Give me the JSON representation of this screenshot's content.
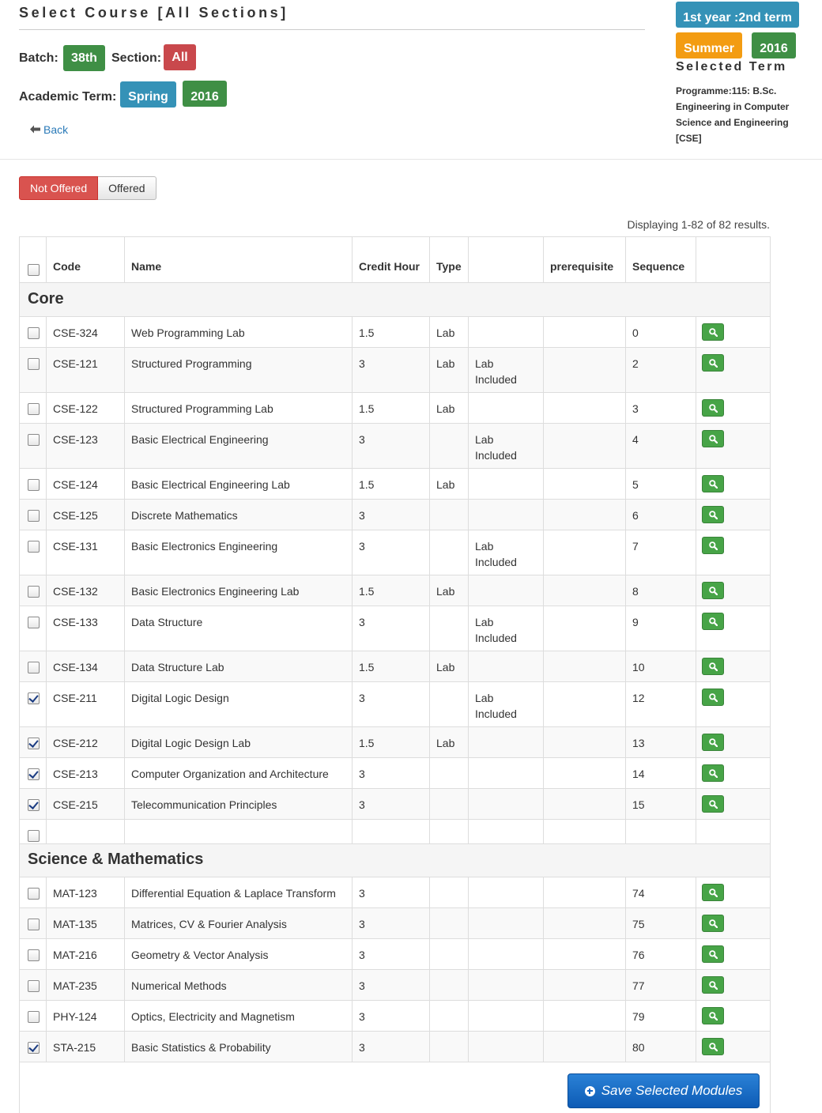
{
  "header": {
    "title": "Select Course [All Sections]",
    "batch_label": "Batch:",
    "batch_value": "38th",
    "section_label": "Section:",
    "section_value": "All",
    "term_label": "Academic Term:",
    "term_value": "Spring",
    "term_year": "2016",
    "back_label": "Back"
  },
  "selected_term": {
    "year_term": "1st year :2nd term",
    "season": "Summer",
    "year": "2016",
    "label": "Selected Term",
    "programme": "Programme:115: B.Sc. Engineering in Computer Science and Engineering [CSE]"
  },
  "filter": {
    "not_offered": "Not Offered",
    "offered": "Offered"
  },
  "summary": "Displaying 1-82 of 82 results.",
  "columns": {
    "code": "Code",
    "name": "Name",
    "credit": "Credit Hour",
    "type": "Type",
    "extra": "",
    "prereq": "prerequisite",
    "sequence": "Sequence"
  },
  "sections": [
    {
      "title": "Core",
      "rows": [
        {
          "code": "CSE-324",
          "name": "Web Programming Lab",
          "credit": "1.5",
          "type": "Lab",
          "extra": "",
          "prereq": "",
          "sequence": "0",
          "checked": false
        },
        {
          "code": "CSE-121",
          "name": "Structured Programming",
          "credit": "3",
          "type": "Lab",
          "extra": "Lab Included",
          "prereq": "",
          "sequence": "2",
          "checked": false
        },
        {
          "code": "CSE-122",
          "name": "Structured Programming Lab",
          "credit": "1.5",
          "type": "Lab",
          "extra": "",
          "prereq": "",
          "sequence": "3",
          "checked": false
        },
        {
          "code": "CSE-123",
          "name": "Basic Electrical Engineering",
          "credit": "3",
          "type": "",
          "extra": "Lab Included",
          "prereq": "",
          "sequence": "4",
          "checked": false
        },
        {
          "code": "CSE-124",
          "name": "Basic Electrical Engineering Lab",
          "credit": "1.5",
          "type": "Lab",
          "extra": "",
          "prereq": "",
          "sequence": "5",
          "checked": false
        },
        {
          "code": "CSE-125",
          "name": "Discrete Mathematics",
          "credit": "3",
          "type": "",
          "extra": "",
          "prereq": "",
          "sequence": "6",
          "checked": false
        },
        {
          "code": "CSE-131",
          "name": "Basic Electronics Engineering",
          "credit": "3",
          "type": "",
          "extra": "Lab Included",
          "prereq": "",
          "sequence": "7",
          "checked": false
        },
        {
          "code": "CSE-132",
          "name": "Basic Electronics Engineering Lab",
          "credit": "1.5",
          "type": "Lab",
          "extra": "",
          "prereq": "",
          "sequence": "8",
          "checked": false
        },
        {
          "code": "CSE-133",
          "name": "Data Structure",
          "credit": "3",
          "type": "",
          "extra": "Lab Included",
          "prereq": "",
          "sequence": "9",
          "checked": false
        },
        {
          "code": "CSE-134",
          "name": "Data Structure Lab",
          "credit": "1.5",
          "type": "Lab",
          "extra": "",
          "prereq": "",
          "sequence": "10",
          "checked": false
        },
        {
          "code": "CSE-211",
          "name": "Digital Logic Design",
          "credit": "3",
          "type": "",
          "extra": "Lab Included",
          "prereq": "",
          "sequence": "12",
          "checked": true
        },
        {
          "code": "CSE-212",
          "name": "Digital Logic Design Lab",
          "credit": "1.5",
          "type": "Lab",
          "extra": "",
          "prereq": "",
          "sequence": "13",
          "checked": true
        },
        {
          "code": "CSE-213",
          "name": "Computer Organization and Architecture",
          "credit": "3",
          "type": "",
          "extra": "",
          "prereq": "",
          "sequence": "14",
          "checked": true
        },
        {
          "code": "CSE-215",
          "name": "Telecommunication Principles",
          "credit": "3",
          "type": "",
          "extra": "",
          "prereq": "",
          "sequence": "15",
          "checked": true
        }
      ]
    },
    {
      "title": "Science & Mathematics",
      "rows": [
        {
          "code": "MAT-123",
          "name": "Differential Equation & Laplace Transform",
          "credit": "3",
          "type": "",
          "extra": "",
          "prereq": "",
          "sequence": "74",
          "checked": false
        },
        {
          "code": "MAT-135",
          "name": "Matrices, CV & Fourier Analysis",
          "credit": "3",
          "type": "",
          "extra": "",
          "prereq": "",
          "sequence": "75",
          "checked": false
        },
        {
          "code": "MAT-216",
          "name": "Geometry & Vector Analysis",
          "credit": "3",
          "type": "",
          "extra": "",
          "prereq": "",
          "sequence": "76",
          "checked": false
        },
        {
          "code": "MAT-235",
          "name": "Numerical Methods",
          "credit": "3",
          "type": "",
          "extra": "",
          "prereq": "",
          "sequence": "77",
          "checked": false
        },
        {
          "code": "PHY-124",
          "name": "Optics, Electricity and Magnetism",
          "credit": "3",
          "type": "",
          "extra": "",
          "prereq": "",
          "sequence": "79",
          "checked": false
        },
        {
          "code": "STA-215",
          "name": "Basic Statistics & Probability",
          "credit": "3",
          "type": "",
          "extra": "",
          "prereq": "",
          "sequence": "80",
          "checked": true
        }
      ]
    }
  ],
  "save_label": "Save Selected Modules",
  "icons": {
    "back": "arrow-left-icon",
    "view": "magnifier-icon",
    "save": "plus-circle-icon"
  },
  "colors": {
    "green_badge": "#3f8f45",
    "red_badge": "#c9484c",
    "blue_badge": "#3592b7",
    "orange_badge": "#f39c12",
    "view_button": "#47a447",
    "save_button": "#1566c5"
  }
}
